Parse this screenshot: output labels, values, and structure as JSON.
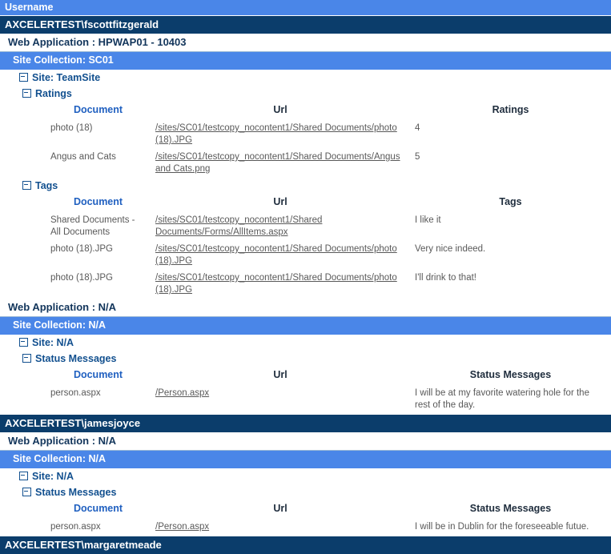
{
  "report": {
    "username_header": "Username",
    "columns": {
      "document": "Document",
      "url": "Url",
      "ratings": "Ratings",
      "tags": "Tags",
      "status_messages": "Status Messages"
    },
    "labels": {
      "web_application_prefix": "Web Application : ",
      "site_collection_prefix": "Site Collection: ",
      "site_prefix": "Site: ",
      "ratings": "Ratings",
      "tags": "Tags",
      "status_messages": "Status Messages",
      "na": "N/A"
    },
    "colors": {
      "band_username_bg": "#4a86e8",
      "band_user_bg": "#0b3d6b",
      "band_sitecollection_bg": "#4a86e8",
      "tree_text": "#12508f",
      "header_document": "#2060c0",
      "header_other": "#1f2d3d",
      "body_text": "#595959"
    },
    "users": [
      {
        "name": "AXCELERTEST\\fscottfitzgerald",
        "web_application": "Web Application : HPWAP01 - 10403",
        "site_collection": "Site Collection: SC01",
        "site": "Site: TeamSite",
        "sections": [
          {
            "title": "Ratings",
            "value_header": "Ratings",
            "rows": [
              {
                "document": "photo (18)",
                "url": "/sites/SC01/testcopy_nocontent1/Shared Documents/photo (18).JPG",
                "value": "4"
              },
              {
                "document": "Angus and Cats",
                "url": "/sites/SC01/testcopy_nocontent1/Shared Documents/Angus and Cats.png",
                "value": "5"
              }
            ]
          },
          {
            "title": "Tags",
            "value_header": "Tags",
            "rows": [
              {
                "document": "Shared Documents - All Documents",
                "url": "/sites/SC01/testcopy_nocontent1/Shared Documents/Forms/AllItems.aspx",
                "value": "I like it"
              },
              {
                "document": "photo (18).JPG",
                "url": "/sites/SC01/testcopy_nocontent1/Shared Documents/photo (18).JPG",
                "value": "Very nice indeed."
              },
              {
                "document": "photo (18).JPG",
                "url": "/sites/SC01/testcopy_nocontent1/Shared Documents/photo (18).JPG",
                "value": "I'll drink to that!"
              }
            ]
          }
        ],
        "second_scope": {
          "web_application": "Web Application : N/A",
          "site_collection": "Site Collection: N/A",
          "site": "Site: N/A",
          "section": {
            "title": "Status Messages",
            "value_header": "Status Messages",
            "rows": [
              {
                "document": "person.aspx",
                "url": "/Person.aspx",
                "value": "I will be at my favorite watering hole for the rest of the day."
              }
            ]
          }
        }
      },
      {
        "name": "AXCELERTEST\\jamesjoyce",
        "web_application": "Web Application : N/A",
        "site_collection": "Site Collection: N/A",
        "site": "Site: N/A",
        "section": {
          "title": "Status Messages",
          "value_header": "Status Messages",
          "rows": [
            {
              "document": "person.aspx",
              "url": "/Person.aspx",
              "value": "I will be in Dublin for the foreseeable futue."
            }
          ]
        }
      },
      {
        "name": "AXCELERTEST\\margaretmeade",
        "truncated": true
      }
    ]
  }
}
